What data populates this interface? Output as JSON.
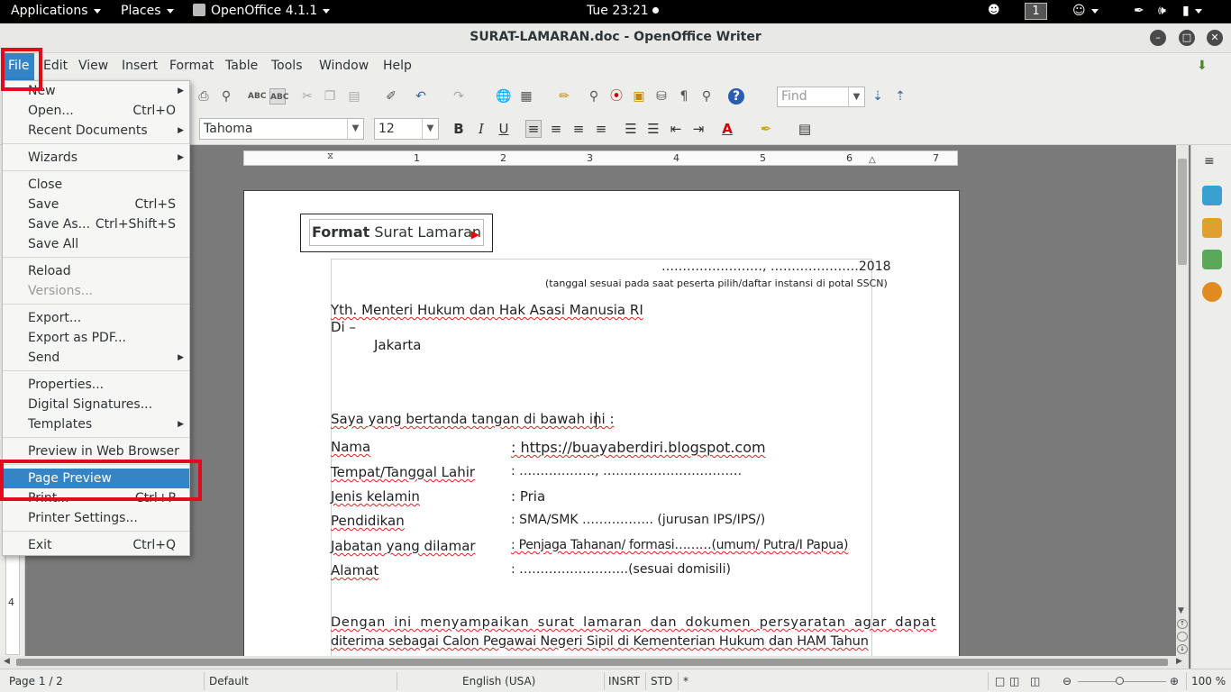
{
  "topbar": {
    "applications": "Applications",
    "places": "Places",
    "app_name": "OpenOffice 4.1.1",
    "clock": "Tue 23:21",
    "workspace": "1"
  },
  "window": {
    "title": "SURAT-LAMARAN.doc - OpenOffice Writer"
  },
  "menubar": [
    "File",
    "Edit",
    "View",
    "Insert",
    "Format",
    "Table",
    "Tools",
    "Window",
    "Help"
  ],
  "toolbar": {
    "find_placeholder": "Find",
    "font_name": "Tahoma",
    "font_size": "12"
  },
  "ruler": {
    "ticks": [
      "1",
      "2",
      "3",
      "4",
      "5",
      "6",
      "7"
    ]
  },
  "file_menu": {
    "items": [
      {
        "label": "New",
        "shortcut": "",
        "submenu": true
      },
      {
        "label": "Open...",
        "shortcut": "Ctrl+O",
        "submenu": false
      },
      {
        "label": "Recent Documents",
        "shortcut": "",
        "submenu": true
      },
      {
        "label": "Wizards",
        "shortcut": "",
        "submenu": true
      },
      {
        "label": "Close",
        "shortcut": "",
        "submenu": false
      },
      {
        "label": "Save",
        "shortcut": "Ctrl+S",
        "submenu": false
      },
      {
        "label": "Save As...",
        "shortcut": "Ctrl+Shift+S",
        "submenu": false
      },
      {
        "label": "Save All",
        "shortcut": "",
        "submenu": false
      },
      {
        "label": "Reload",
        "shortcut": "",
        "submenu": false
      },
      {
        "label": "Versions...",
        "shortcut": "",
        "submenu": false,
        "disabled": true
      },
      {
        "label": "Export...",
        "shortcut": "",
        "submenu": false
      },
      {
        "label": "Export as PDF...",
        "shortcut": "",
        "submenu": false
      },
      {
        "label": "Send",
        "shortcut": "",
        "submenu": true
      },
      {
        "label": "Properties...",
        "shortcut": "",
        "submenu": false
      },
      {
        "label": "Digital Signatures...",
        "shortcut": "",
        "submenu": false
      },
      {
        "label": "Templates",
        "shortcut": "",
        "submenu": true
      },
      {
        "label": "Preview in Web Browser",
        "shortcut": "",
        "submenu": false
      },
      {
        "label": "Page Preview",
        "shortcut": "",
        "submenu": false,
        "highlighted": true
      },
      {
        "label": "Print...",
        "shortcut": "Ctrl+P",
        "submenu": false
      },
      {
        "label": "Printer Settings...",
        "shortcut": "",
        "submenu": false
      },
      {
        "label": "Exit",
        "shortcut": "Ctrl+Q",
        "submenu": false
      }
    ]
  },
  "document": {
    "box_label_bold": "Format",
    "box_label_rest": " Surat Lamaran",
    "date_line": "……………………, …………………2018",
    "date_note": "(tanggal sesuai pada saat peserta pilih/daftar instansi di potal SSCN)",
    "recipient_1": "Yth. Menteri Hukum dan Hak Asasi Manusia RI",
    "recipient_2": "Di –",
    "recipient_3": "Jakarta",
    "intro": "Saya yang bertanda tangan di bawah ini :",
    "fields": [
      {
        "label": "Nama",
        "value": ": https://buayaberdiri.blogspot.com"
      },
      {
        "label": "Tempat/Tanggal Lahir",
        "value": ": ………………, ……………………………"
      },
      {
        "label": "Jenis kelamin",
        "value": ": Pria"
      },
      {
        "label": "Pendidikan",
        "value": ": SMA/SMK …………….. (jurusan IPS/IPS/)"
      },
      {
        "label": "Jabatan yang dilamar",
        "value": ": Penjaga Tahanan/ formasi………(umum/ Putra/I Papua)"
      },
      {
        "label": "Alamat",
        "value": ": ……………………..(sesuai domisili)"
      }
    ],
    "para_1": "Dengan ini menyampaikan surat lamaran dan dokumen persyaratan agar dapat",
    "para_2": "diterima sebagai Calon Pegawai Negeri Sipil di Kementerian Hukum dan HAM Tahun"
  },
  "statusbar": {
    "page": "Page 1 / 2",
    "style": "Default",
    "language": "English (USA)",
    "insert_mode": "INSRT",
    "selection_mode": "STD",
    "modified": "*",
    "zoom": "100 %"
  },
  "colors": {
    "highlight": "#3584c6",
    "callout": "#e00b1c"
  }
}
